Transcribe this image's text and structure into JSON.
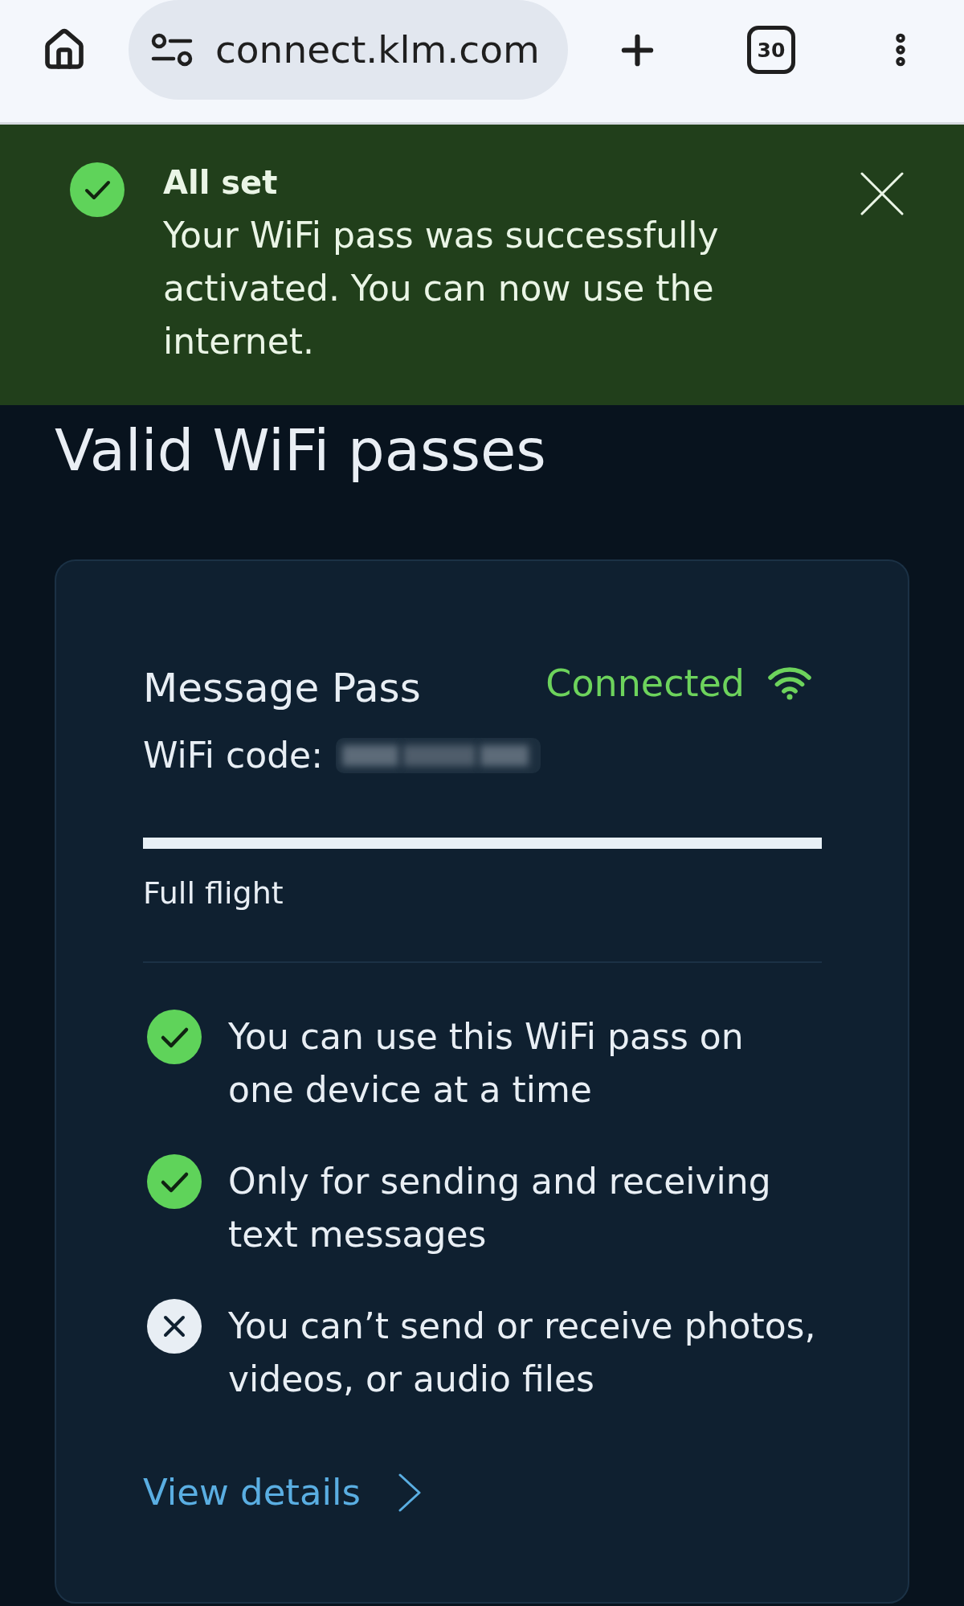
{
  "browser": {
    "url": "connect.klm.com",
    "tab_count": "30"
  },
  "banner": {
    "kind": "success",
    "title": "All set",
    "message": "Your WiFi pass was successfully activated. You can now use the internet."
  },
  "heading": "Valid WiFi passes",
  "pass": {
    "name": "Message Pass",
    "status": {
      "label": "Connected",
      "connected": true
    },
    "code": {
      "label": "WiFi code:",
      "blurred": true
    },
    "progress": {
      "level": 1
    },
    "duration": "Full flight",
    "features": [
      {
        "text": "You can use this WiFi pass on one device at a time",
        "included": true
      },
      {
        "text": "Only for sending and receiving text messages",
        "included": true
      },
      {
        "text": "You can’t send or receive photos, videos, or audio files",
        "included": false
      }
    ],
    "link": {
      "label": "View details"
    }
  }
}
